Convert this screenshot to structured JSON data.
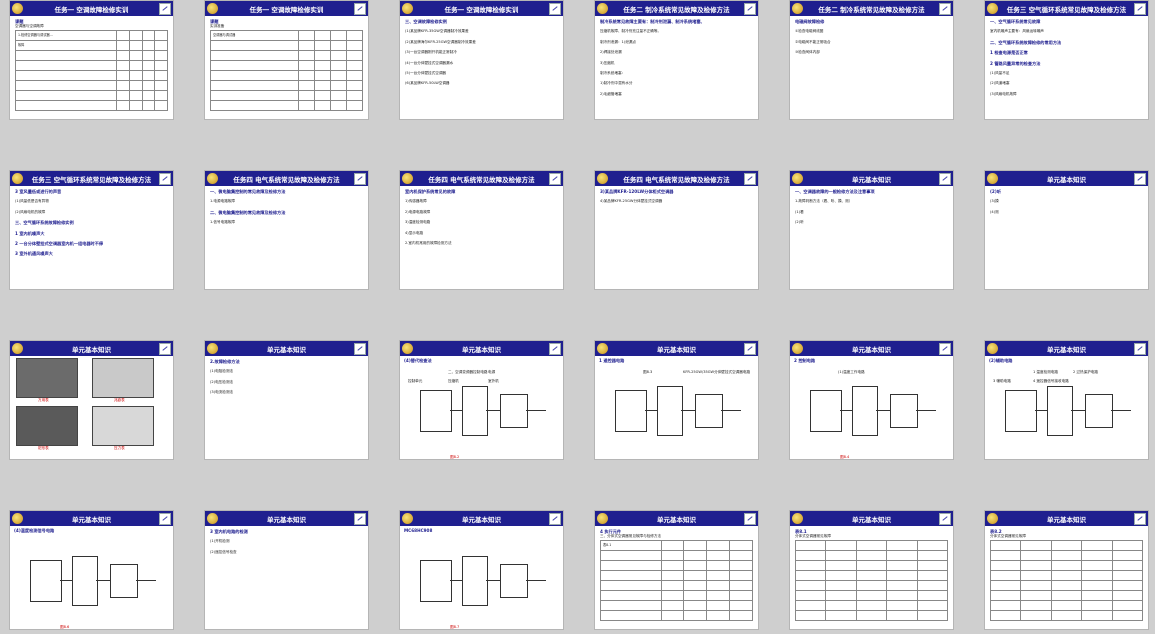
{
  "grid": {
    "slides": [
      {
        "id": 1,
        "title": "任务一 空调故障检修实训",
        "kind": "table",
        "lines": [
          "课题",
          "空调器与空调故障",
          "1.检修空调器与调试器...",
          "故障"
        ]
      },
      {
        "id": 2,
        "title": "任务一 空调故障检修实训",
        "kind": "table",
        "lines": [
          "课题",
          "实训准备",
          "空调器与调试器"
        ]
      },
      {
        "id": 3,
        "title": "任务一 空调故障检修实训",
        "kind": "text",
        "lines": [
          "三、空调故障检修实例",
          "(1)某品牌KFR-35GW空调器制冷效果差",
          "(2)某品牌海尔KFR-25GW空调器制冷效果差",
          "(3)一台空调器刚开机能正常制冷",
          "(4)一台分体壁挂式空调器漏水",
          "(5)一台分体壁挂式空调器",
          "(6)某品牌KFR-50LW空调器"
        ]
      },
      {
        "id": 4,
        "title": "任务二 制冷系统常见故障及检修方法",
        "kind": "text",
        "lines": [
          "制冷系统常见故障主要有：制冷剂泄漏、制冷系统堵塞、",
          "压缩机故障、制冷剂充注量不正确等。",
          "制冷剂泄漏：1)泄漏点",
          "2)焊接处泄漏",
          "3)压缩机",
          "制冷系统堵塞：",
          "1)制冷剂中混有水分",
          "2)毛细管堵塞"
        ]
      },
      {
        "id": 5,
        "title": "任务二 制冷系统常见故障及检修方法",
        "kind": "text",
        "lines": [
          "电磁阀故障检修",
          "①检查电磁阀线圈",
          "②电磁阀不能正常吸合",
          "③检查阀体内部"
        ]
      },
      {
        "id": 6,
        "title": "任务三 空气循环系统常见故障及检修方法",
        "kind": "text",
        "lines": [
          "一、空气循环系统常见故障",
          "室内机噪声主要有：风扇运转噪声",
          "二、空气循环系统故障检修的常用方法",
          "1 检查电源是否正常",
          "2 管路风量异常的检查方法",
          "(1)风量不足",
          "(2)风道堵塞",
          "(3)风扇电机故障"
        ]
      },
      {
        "id": 7,
        "title": "任务三 空气循环系统常见故障及检修方法",
        "kind": "text",
        "lines": [
          "3 室风量低或进行的声音",
          "(1)风量低是否有异物",
          "(2)风扇电机的故障",
          "三、空气循环系统故障检修实例",
          "1 室内机噪声大",
          "2 一台分体壁挂式空调器室内机一组电器时不停",
          "3 室外机通风噪声大"
        ]
      },
      {
        "id": 8,
        "title": "任务四 电气系统常见故障及检修方法",
        "kind": "text",
        "lines": [
          "一、微电脑集控制的常见故障及检修方法",
          "1.电源电路故障",
          "二、微电脑集控制的常见故障及检修方法",
          "1.信号电路故障"
        ]
      },
      {
        "id": 9,
        "title": "任务四 电气系统常见故障及检修方法",
        "kind": "text",
        "lines": [
          "室内机保护系统常见的故障",
          "1)传感器故障",
          "2)电源电路故障",
          "3)温度检测电路",
          "4)显示电路",
          "2.室内机常用的故障检测方法"
        ]
      },
      {
        "id": 10,
        "title": "任务四 电气系统常见故障及检修方法",
        "kind": "text",
        "lines": [
          "3)某品牌KFR-120LW分体柜式空调器",
          "4)某品牌KFR-25GW分体壁挂式空调器"
        ]
      },
      {
        "id": 11,
        "title": "单元基本知识",
        "kind": "text",
        "lines": [
          "一、空调器故障的一般检修方法及注意事项",
          "1.故障判断方法（看、听、摸、测）",
          "(1)看",
          "(2)听"
        ]
      },
      {
        "id": 12,
        "title": "单元基本知识",
        "kind": "text",
        "lines": [
          "(2)听",
          "(3)摸",
          "(4)测"
        ]
      },
      {
        "id": 13,
        "title": "单元基本知识",
        "kind": "photos",
        "lines": [
          "万用表",
          "兆欧表",
          "钳形表",
          "压力表"
        ]
      },
      {
        "id": 14,
        "title": "单元基本知识",
        "kind": "text",
        "lines": [
          "2.故障检修方法",
          "(1)电阻检测法",
          "(2)电压检测法",
          "(3)电流检测法"
        ]
      },
      {
        "id": 15,
        "title": "单元基本知识",
        "kind": "diagram",
        "lines": [
          "(4)替代检查法",
          "二、空调变频器控制电路",
          "电源",
          "控制单元",
          "压缩机",
          "室外机",
          "图8.2"
        ]
      },
      {
        "id": 16,
        "title": "单元基本知识",
        "kind": "schematic",
        "lines": [
          "1 遥控器电路",
          "图8.3",
          "KFR-25GW/35GW分体壁挂式空调器电路"
        ]
      },
      {
        "id": 17,
        "title": "单元基本知识",
        "kind": "schematic",
        "lines": [
          "2 控制电路",
          "(1)温度工作电路",
          "图8.4"
        ]
      },
      {
        "id": 18,
        "title": "单元基本知识",
        "kind": "schematic",
        "lines": [
          "(2)辅助电路",
          "1 温度检测电路",
          "2 过热保护电路",
          "3 辅助电路",
          "4 遥控器信号接收电路"
        ]
      },
      {
        "id": 19,
        "title": "单元基本知识",
        "kind": "schematic",
        "lines": [
          "(4)温度检测信号电路",
          "图8.6"
        ]
      },
      {
        "id": 20,
        "title": "单元基本知识",
        "kind": "text",
        "lines": [
          "3 室内机电路的检测",
          "(1)开机检测",
          "(2)遥控信号检查"
        ]
      },
      {
        "id": 21,
        "title": "单元基本知识",
        "kind": "schematic",
        "lines": [
          "MC68HC908",
          "图8.7"
        ]
      },
      {
        "id": 22,
        "title": "单元基本知识",
        "kind": "table",
        "lines": [
          "4 执行元件",
          "三、分体式空调器常见故障与检修方法",
          "表8.1"
        ]
      },
      {
        "id": 23,
        "title": "单元基本知识",
        "kind": "table",
        "lines": [
          "表8.1",
          "分体式空调器常见故障"
        ]
      },
      {
        "id": 24,
        "title": "单元基本知识",
        "kind": "table",
        "lines": [
          "表8.2",
          "分体式空调器常见故障"
        ]
      }
    ]
  }
}
